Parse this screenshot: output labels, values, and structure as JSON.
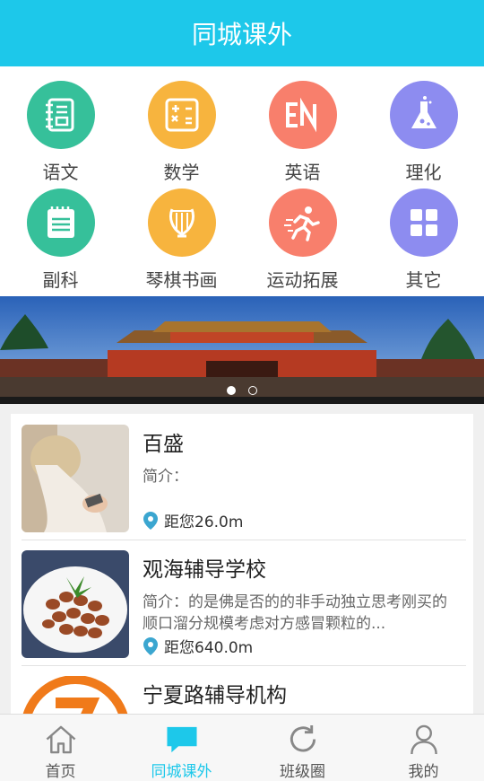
{
  "header": {
    "title": "同城课外"
  },
  "categories": [
    {
      "label": "语文",
      "icon": "chinese-book-icon",
      "color": "#36c09a"
    },
    {
      "label": "数学",
      "icon": "calculator-icon",
      "color": "#f7b43e"
    },
    {
      "label": "英语",
      "icon": "en-letters-icon",
      "color": "#f87f6c"
    },
    {
      "label": "理化",
      "icon": "flask-icon",
      "color": "#8d8cf0"
    },
    {
      "label": "副科",
      "icon": "notepad-icon",
      "color": "#36c09a"
    },
    {
      "label": "琴棋书画",
      "icon": "lyre-icon",
      "color": "#f7b43e"
    },
    {
      "label": "运动拓展",
      "icon": "running-man-icon",
      "color": "#f87f6c"
    },
    {
      "label": "其它",
      "icon": "grid-squares-icon",
      "color": "#8d8cf0"
    }
  ],
  "banner": {
    "slides": 2,
    "active_slide": 1
  },
  "listings": [
    {
      "name": "百盛",
      "intro": "简介：",
      "distance": "距您26.0m"
    },
    {
      "name": "观海辅导学校",
      "intro": "简介：的是佛是否的的非手动独立思考刚买的顺口溜分规模考虑对方感冒颗粒的...",
      "distance": "距您640.0m"
    },
    {
      "name": "宁夏路辅导机构",
      "intro": "",
      "distance": ""
    }
  ],
  "tabbar": {
    "tabs": [
      {
        "label": "首页",
        "icon": "home-icon"
      },
      {
        "label": "同城课外",
        "icon": "chat-bubble-icon"
      },
      {
        "label": "班级圈",
        "icon": "refresh-icon"
      },
      {
        "label": "我的",
        "icon": "person-icon"
      }
    ],
    "active_tab": "同城课外"
  },
  "colors": {
    "accent": "#1dc8ea",
    "pin": "#3ba6d0"
  }
}
